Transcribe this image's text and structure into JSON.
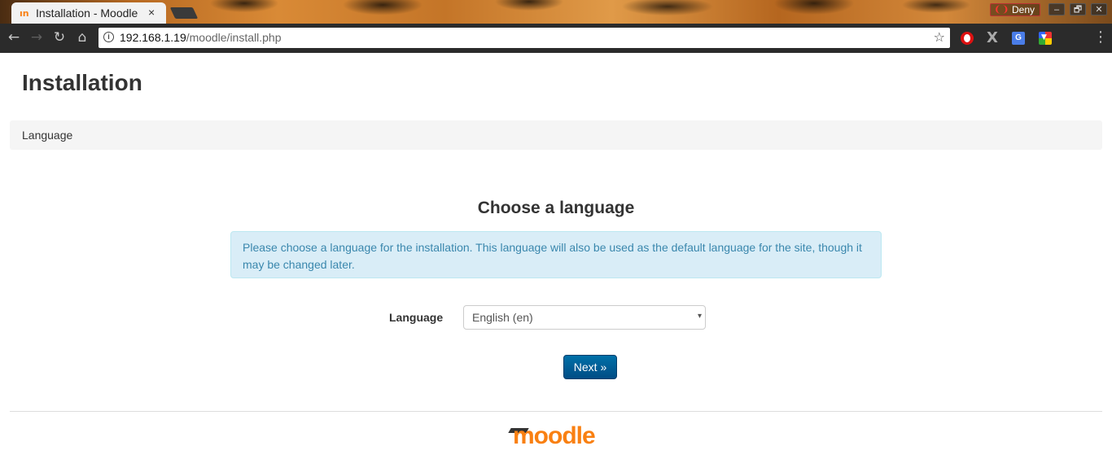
{
  "browser": {
    "tab_title": "Installation - Moodle",
    "favicon": "ın",
    "tab_close": "×",
    "deny_label": "Deny",
    "url_host": "192.168.1.19",
    "url_path": "/moodle/install.php",
    "window_buttons": {
      "minimize": "–",
      "maximize": "🗗",
      "close": "✕"
    }
  },
  "page": {
    "title": "Installation",
    "breadcrumb": "Language",
    "section_title": "Choose a language",
    "info_text": "Please choose a language for the installation. This language will also be used as the default language for the site, though it may be changed later.",
    "language_label": "Language",
    "language_selected": "English (en)",
    "next_button": "Next »",
    "logo_text": "moodle"
  },
  "colors": {
    "brand": "#f98012",
    "primary_button": "#005a94",
    "info_bg": "#d9edf7",
    "info_text": "#3a87ad"
  }
}
